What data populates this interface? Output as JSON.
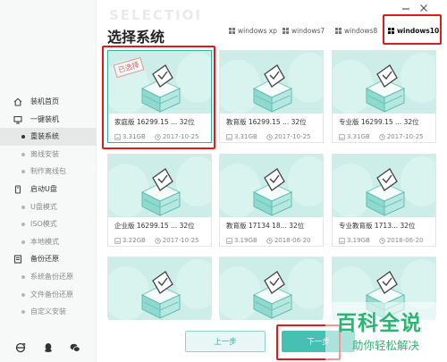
{
  "sidebar": {
    "items": [
      {
        "label": "装机首页",
        "kind": "group",
        "icon": "home-icon"
      },
      {
        "label": "一键装机",
        "kind": "group",
        "icon": "monitor-icon"
      },
      {
        "label": "重装系统",
        "kind": "sub",
        "active": true
      },
      {
        "label": "离线安装",
        "kind": "sub"
      },
      {
        "label": "制作离线包",
        "kind": "sub"
      },
      {
        "label": "启动U盘",
        "kind": "group",
        "icon": "usb-drive-icon"
      },
      {
        "label": "U盘模式",
        "kind": "sub"
      },
      {
        "label": "ISO模式",
        "kind": "sub"
      },
      {
        "label": "本地模式",
        "kind": "sub"
      },
      {
        "label": "备份还原",
        "kind": "group",
        "icon": "backup-icon"
      },
      {
        "label": "系统备份还原",
        "kind": "sub"
      },
      {
        "label": "文件备份还原",
        "kind": "sub"
      },
      {
        "label": "自定义安装",
        "kind": "sub"
      }
    ],
    "bottom_icons": [
      "ie-browser-icon",
      "qq-icon",
      "wechat-icon"
    ]
  },
  "header": {
    "watermark": "SELECTIOI",
    "title": "选择系统"
  },
  "tabs": [
    {
      "label": "windows xp"
    },
    {
      "label": "windows7"
    },
    {
      "label": "windows8"
    },
    {
      "label": "windows10",
      "active": true
    }
  ],
  "cards": [
    {
      "name": "家庭版 16299.15 ... 32位",
      "size": "3.31GB",
      "date": "2017-10-25",
      "selected": true,
      "badge": "已选择"
    },
    {
      "name": "教育版 16299.15 ... 32位",
      "size": "3.31GB",
      "date": "2017-10-25"
    },
    {
      "name": "专业版 16299.15 ... 32位",
      "size": "3.31GB",
      "date": "2017-10-25"
    },
    {
      "name": "企业版 16299.15 ... 32位",
      "size": "3.22GB",
      "date": "2017-10-25"
    },
    {
      "name": "教育版 17134 18... 32位",
      "size": "3.19GB",
      "date": "2018-06-20"
    },
    {
      "name": "专业教育版 1713... 32位",
      "size": "3.19GB",
      "date": "2018-06-20"
    },
    {
      "name": "",
      "size": "",
      "date": ""
    },
    {
      "name": "",
      "size": "",
      "date": ""
    },
    {
      "name": "",
      "size": "",
      "date": ""
    }
  ],
  "buttons": {
    "prev": "上一步",
    "next": "下一步"
  },
  "watermark_brand": {
    "line1": "百科全说",
    "line2": "助你轻松解决"
  },
  "colors": {
    "accent": "#45c0b2",
    "highlight_box": "#e0191b",
    "card_bg": "#cdeee8",
    "brand_green": "#2bb573"
  }
}
